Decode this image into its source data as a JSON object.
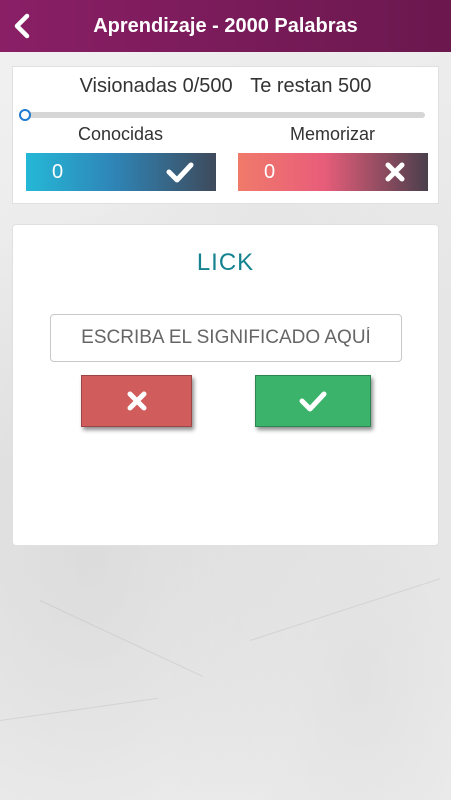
{
  "header": {
    "title": "Aprendizaje - 2000 Palabras",
    "back_icon": "chevron-left-icon",
    "bar_color": "#7a1b5a"
  },
  "stats": {
    "viewed_label": "Visionadas 0/500",
    "remaining_label": "Te restan 500",
    "progress": 0,
    "known_label": "Conocidas",
    "memorize_label": "Memorizar",
    "known_count": "0",
    "memorize_count": "0",
    "known_icon": "check-icon",
    "memorize_icon": "close-icon"
  },
  "card": {
    "word": "LICK",
    "input_value": "",
    "input_placeholder": "ESCRIBA EL SIGNIFICADO AQUÍ",
    "wrong_button_icon": "close-icon",
    "correct_button_icon": "check-icon",
    "wrong_color": "#d05c5c",
    "correct_color": "#3bb36b",
    "word_color": "#15838f"
  }
}
